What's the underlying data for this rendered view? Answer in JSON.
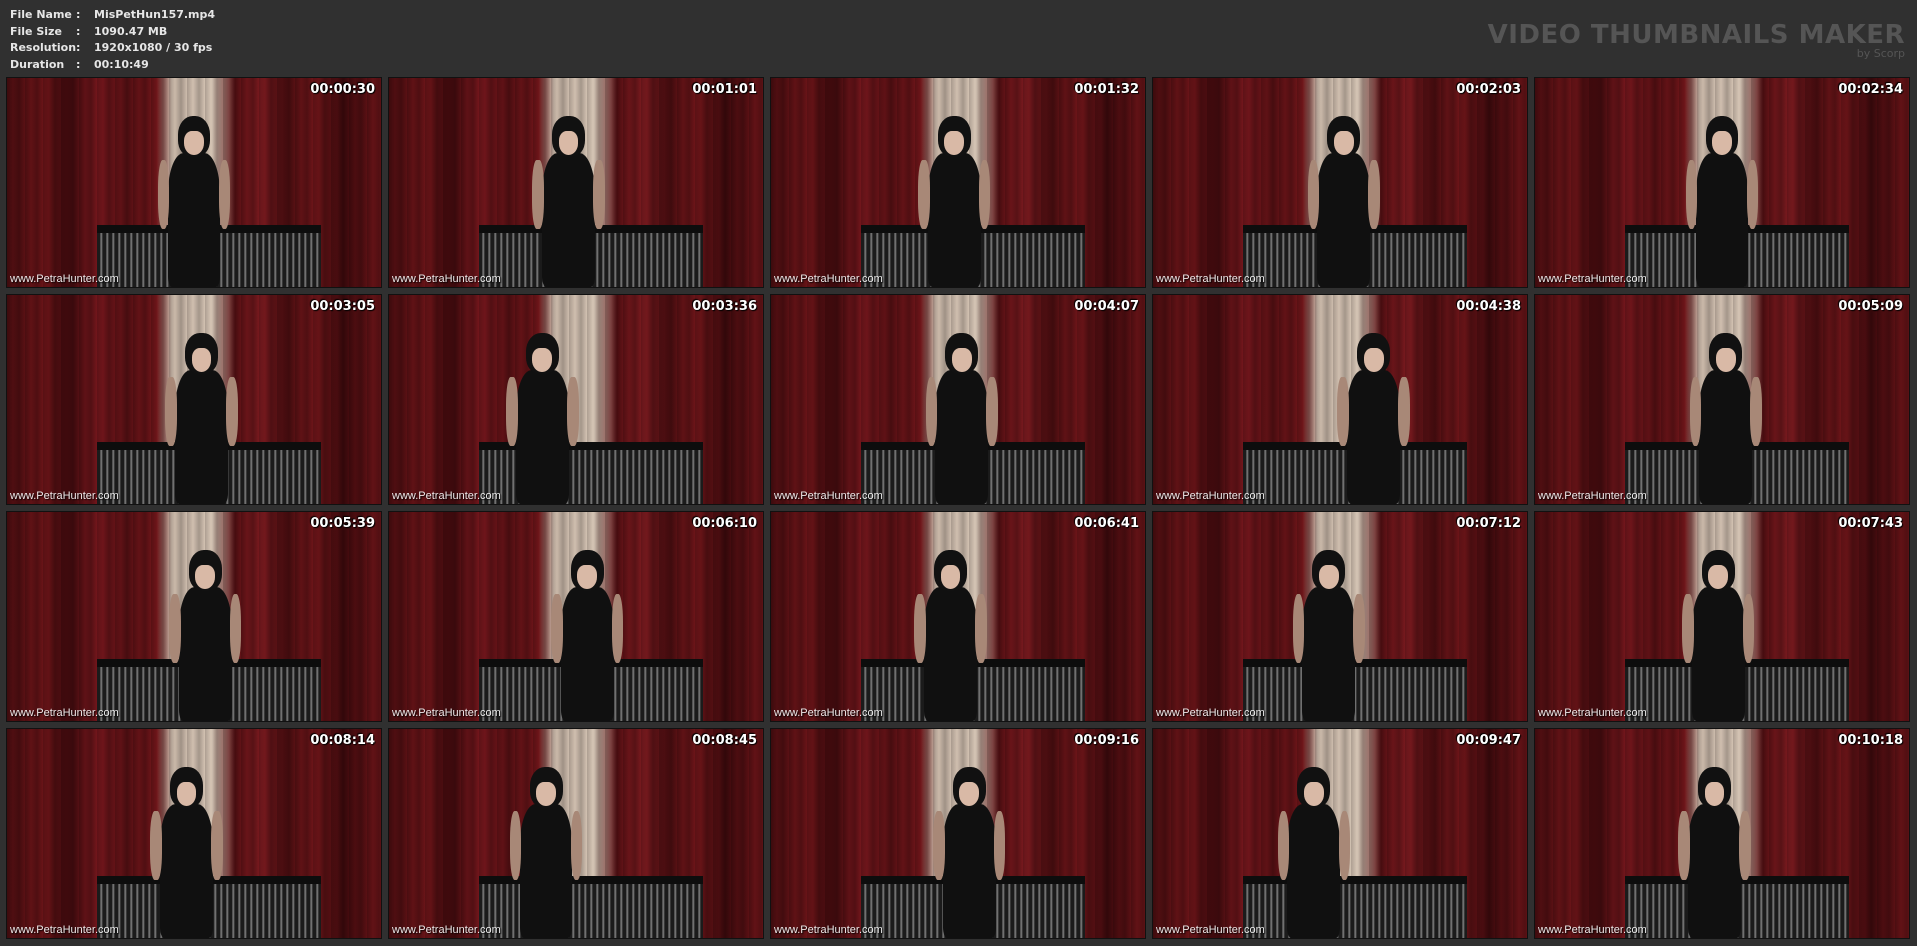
{
  "file_info": {
    "file_name_label": "File Name",
    "file_name": "MisPetHun157.mp4",
    "file_size_label": "File Size",
    "file_size": "1090.47 MB",
    "resolution_label": "Resolution",
    "resolution": "1920x1080 / 30 fps",
    "duration_label": "Duration",
    "duration": "00:10:49",
    "separator": ":"
  },
  "brand": {
    "title": "VIDEO THUMBNAILS MAKER",
    "subtitle": "by Scorp"
  },
  "watermark": "www.PetraHunter.com",
  "thumbnails": [
    {
      "time": "00:00:30"
    },
    {
      "time": "00:01:01"
    },
    {
      "time": "00:01:32"
    },
    {
      "time": "00:02:03"
    },
    {
      "time": "00:02:34"
    },
    {
      "time": "00:03:05"
    },
    {
      "time": "00:03:36"
    },
    {
      "time": "00:04:07"
    },
    {
      "time": "00:04:38"
    },
    {
      "time": "00:05:09"
    },
    {
      "time": "00:05:39"
    },
    {
      "time": "00:06:10"
    },
    {
      "time": "00:06:41"
    },
    {
      "time": "00:07:12"
    },
    {
      "time": "00:07:43"
    },
    {
      "time": "00:08:14"
    },
    {
      "time": "00:08:45"
    },
    {
      "time": "00:09:16"
    },
    {
      "time": "00:09:47"
    },
    {
      "time": "00:10:18"
    }
  ]
}
